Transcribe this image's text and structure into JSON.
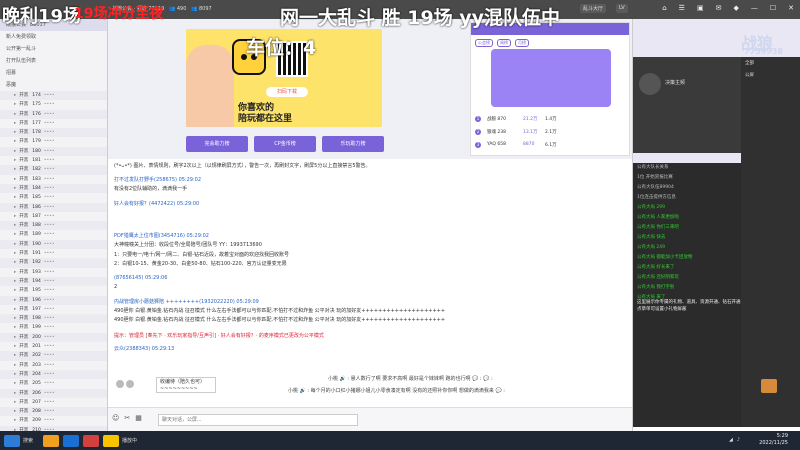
{
  "overlay": {
    "left": "晚利19场",
    "red": "19场冲分至夜",
    "right_line1": "网一大乱斗 胜 19场  yy混队伍中",
    "right_line2": "车位：4",
    "watermark_name": "战狼",
    "watermark_id": "7759938"
  },
  "topbar": {
    "room_title": "战狼公会 · 频道 77519",
    "online": "490",
    "fans": "8097",
    "tabs": [
      "乱斗大厅",
      "LV"
    ],
    "icons": [
      "home-icon",
      "menu-icon",
      "gamepad-icon",
      "mail-icon",
      "shirt-icon",
      "minimize-icon",
      "maximize-icon",
      "close-icon"
    ]
  },
  "tree": {
    "rooms": [
      {
        "label": "战狼公会",
        "count": "88017"
      },
      {
        "label": "新人免费领取"
      },
      {
        "label": "公开第一乱斗"
      },
      {
        "label": "打开队伍列表"
      },
      {
        "label": "招募"
      },
      {
        "label": "恶魔"
      }
    ],
    "rows": [
      {
        "name": "开黑",
        "num": "174",
        "pw": "••••"
      },
      {
        "name": "开黑",
        "num": "175",
        "pw": "••••"
      },
      {
        "name": "开黑",
        "num": "176",
        "pw": "••••"
      },
      {
        "name": "开黑",
        "num": "177",
        "pw": "••••"
      },
      {
        "name": "开黑",
        "num": "178",
        "pw": "••••"
      },
      {
        "name": "开黑",
        "num": "179",
        "pw": "••••"
      },
      {
        "name": "开黑",
        "num": "180",
        "pw": "••••"
      },
      {
        "name": "开黑",
        "num": "181",
        "pw": "••••"
      },
      {
        "name": "开黑",
        "num": "182",
        "pw": "••••"
      },
      {
        "name": "开黑",
        "num": "183",
        "pw": "••••"
      },
      {
        "name": "开黑",
        "num": "184",
        "pw": "••••"
      },
      {
        "name": "开黑",
        "num": "185",
        "pw": "••••"
      },
      {
        "name": "开黑",
        "num": "186",
        "pw": "••••"
      },
      {
        "name": "开黑",
        "num": "187",
        "pw": "••••"
      },
      {
        "name": "开黑",
        "num": "188",
        "pw": "••••"
      },
      {
        "name": "开黑",
        "num": "189",
        "pw": "••••"
      },
      {
        "name": "开黑",
        "num": "190",
        "pw": "••••"
      },
      {
        "name": "开黑",
        "num": "191",
        "pw": "••••"
      },
      {
        "name": "开黑",
        "num": "192",
        "pw": "••••"
      },
      {
        "name": "开黑",
        "num": "193",
        "pw": "••••"
      },
      {
        "name": "开黑",
        "num": "194",
        "pw": "••••"
      },
      {
        "name": "开黑",
        "num": "195",
        "pw": "••••"
      },
      {
        "name": "开黑",
        "num": "196",
        "pw": "••••"
      },
      {
        "name": "开黑",
        "num": "197",
        "pw": "••••"
      },
      {
        "name": "开黑",
        "num": "198",
        "pw": "••••"
      },
      {
        "name": "开黑",
        "num": "199",
        "pw": "••••"
      },
      {
        "name": "开黑",
        "num": "200",
        "pw": "••••"
      },
      {
        "name": "开黑",
        "num": "201",
        "pw": "••••"
      },
      {
        "name": "开黑",
        "num": "202",
        "pw": "••••"
      },
      {
        "name": "开黑",
        "num": "203",
        "pw": "••••"
      },
      {
        "name": "开黑",
        "num": "204",
        "pw": "••••"
      },
      {
        "name": "开黑",
        "num": "205",
        "pw": "••••"
      },
      {
        "name": "开黑",
        "num": "206",
        "pw": "••••"
      },
      {
        "name": "开黑",
        "num": "207",
        "pw": "••••"
      },
      {
        "name": "开黑",
        "num": "208",
        "pw": "••••"
      },
      {
        "name": "开黑",
        "num": "209",
        "pw": "••••"
      },
      {
        "name": "开黑",
        "num": "210",
        "pw": "••••"
      },
      {
        "name": "开黑",
        "num": "211",
        "pw": "••••"
      }
    ]
  },
  "banner": {
    "slogan_line1": "你喜欢的",
    "slogan_line2": "陪玩都在这里",
    "download": "扫码下载",
    "buttons": [
      "完会助力榜",
      "CP金币榜",
      "乐玩助力榜"
    ],
    "rank_tabs": [
      "公会榜",
      "周榜",
      "月榜"
    ],
    "rank": [
      {
        "n": "1",
        "name": "战狼 870",
        "score": "21.2万",
        "v": "1.4万"
      },
      {
        "n": "2",
        "name": "狼魂 238",
        "score": "13.1万",
        "v": "2.1万"
      },
      {
        "n": "3",
        "name": "YAQ 658",
        "score": "8870",
        "v": "6.1万"
      }
    ]
  },
  "chat": {
    "messages": [
      {
        "text": "(*•ᴗ•*)    图片、表情规则，刷字2次以上（以规律刷屏方式），警告一次，再刷封文字，刷屏5分以上直接禁言5警告。",
        "cls": "msg"
      },
      {
        "text": "打不过发队打野手(258675)  05:29:02",
        "cls": "msg name"
      },
      {
        "text": "有没有2位队辅助的，滴滴我一手",
        "cls": "msg"
      },
      {
        "text": "好人会有好报？(4472422)  05:29:00",
        "cls": "msg name"
      },
      {
        "text": "PDF猎鹰太上位市图(3454716)  05:29:02",
        "cls": "msg name"
      },
      {
        "text": "大神幢幢关上分团：收段位号/全局陪号/团队号 YY：1993713690",
        "cls": "msg"
      },
      {
        "text": "1：只要电一/电十/网一/网二、白银-钻石近段，故着宝对面的欢迎找我回收账号",
        "cls": "msg"
      },
      {
        "text": "2：白银10-15、黄金20-30、白金50-80、钻石100-220、官方认证量变无限",
        "cls": "msg"
      },
      {
        "text": "(87656145)  05:29:06",
        "cls": "msg name"
      },
      {
        "text": "2",
        "cls": "msg"
      },
      {
        "text": "内战管理房小蘑菇狮陪 ++++++++(1932022220)  05:29:09",
        "cls": "msg name"
      },
      {
        "text": "490胆你 白银.黄铂金.钻石内战 征召模式   什么左右手法都可以与你匹配.不怕打不过和炸鱼 公平对决  玩的加好友++++++++++++++++++++",
        "cls": "msg"
      },
      {
        "text": "490胆你 白银.黄铂金.钻石内战 征召模式   什么左右手法都可以与你匹配.不怕打不过和炸鱼 公平对决  玩的加好友++++++++++++++++++++",
        "cls": "msg"
      },
      {
        "text": "提示：管理员 [奉先下 · 欢乐玩家指导/互声引] · 好人会有好报？· 的麦序模式已更改为公平模式",
        "cls": "msg sys"
      },
      {
        "text": "云众(2388343)  05:29:13",
        "cls": "msg name"
      }
    ],
    "tag_line1": "收编待（陪久也可）",
    "tag_line2": "~~~~~~~~~",
    "ticker1": "小桃 🔊 : 悬人数行了啊 要求不高啊 最好是个妹妹啊 跑的也行啊 💬 : 💬 :",
    "ticker2": "小桃 🔊 : 每个月的小口红小猪娜小姐儿小零食凑定有啊 没有的还照补你你啊 想做的滴滴我来 💬 :",
    "input_placeholder": "聊天对话，公屏..."
  },
  "right": {
    "mic_title": "决策主频",
    "log": [
      {
        "t": "公有大队长关系",
        "c": "w"
      },
      {
        "t": "1位   开始赏报比赛",
        "c": "w"
      },
      {
        "t": "公有大队伍89904",
        "c": "w"
      },
      {
        "t": "1位连击提供方信息",
        "c": "w"
      },
      {
        "t": "公有大局   299",
        "c": "g"
      },
      {
        "t": "公有大局   人家更加啦",
        "c": "g"
      },
      {
        "t": "公有大局   你们三来吧",
        "c": "g"
      },
      {
        "t": "公有大局   快去",
        "c": "g"
      },
      {
        "t": "公有大局   249",
        "c": "g"
      },
      {
        "t": "公有大局   都能加小卡团放物",
        "c": "g"
      },
      {
        "t": "公有大局   好长来了",
        "c": "g"
      },
      {
        "t": "公有大局   还好阴家玩",
        "c": "g"
      },
      {
        "t": "公有大局   我打字别",
        "c": "g"
      },
      {
        "t": "公有大局   来了",
        "c": "g"
      }
    ],
    "side_lines": [
      "全部",
      "公屏"
    ],
    "notes": [
      "这里展示你专属的礼物、道具、资源开通、钻石开通",
      "点草单可设置小礼物屏蔽"
    ]
  },
  "taskbar": {
    "search_label": "搜索",
    "app_label": "播放中",
    "time": "5:29",
    "date": "2022/11/25"
  }
}
